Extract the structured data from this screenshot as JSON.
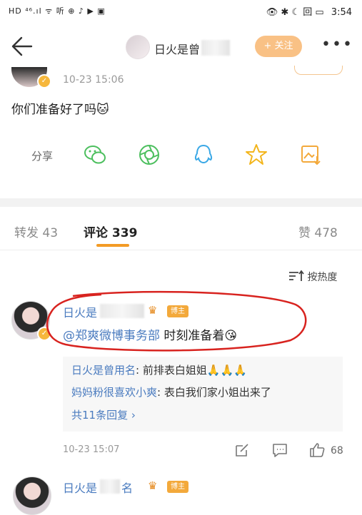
{
  "status_bar": {
    "left": "HD ⁴⁶.ıl ᯤ 听 ⊕ ♪ ▶ ▣",
    "right_icons": "👁 ✱ ☾ 回 ▭",
    "time": "3:54"
  },
  "header": {
    "title": "日火是曾",
    "follow_label": "+ 关注",
    "more": "•••"
  },
  "post": {
    "time": "10-23 15:06",
    "text": "你们准备好了吗",
    "emoji": "🐱",
    "share_label": "分享",
    "share_icons": [
      "wechat-icon",
      "moments-icon",
      "qq-icon",
      "qzone-icon",
      "save-image-icon"
    ]
  },
  "tabs": {
    "repost_label": "转发",
    "repost_count": "43",
    "comment_label": "评论",
    "comment_count": "339",
    "like_label": "赞",
    "like_count": "478"
  },
  "sort": {
    "label": "按热度"
  },
  "comment": {
    "name_prefix": "日火是",
    "crown": "♛",
    "badge": "博主",
    "mention": "@郑爽微博事务部",
    "text": " 时刻准备着",
    "emoji": "😘",
    "replies": [
      {
        "name": "日火是曾用名",
        "text": ": 前排表白姐姐",
        "emoji": "🙏🙏🙏"
      },
      {
        "name": "妈妈粉很喜欢小爽",
        "text": ": 表白我们家小姐出来了",
        "emoji": ""
      }
    ],
    "more_replies": "共11条回复 ›",
    "time": "10-23 15:07",
    "like_count": "68"
  },
  "next_comment": {
    "name_prefix": "日火是",
    "name_suffix": "名",
    "crown": "♛",
    "badge": "博主"
  },
  "colors": {
    "accent_orange": "#f39b25",
    "link_blue": "#4a7bbf",
    "follow_bg": "#f9c185",
    "annotation_red": "#d8231f"
  }
}
